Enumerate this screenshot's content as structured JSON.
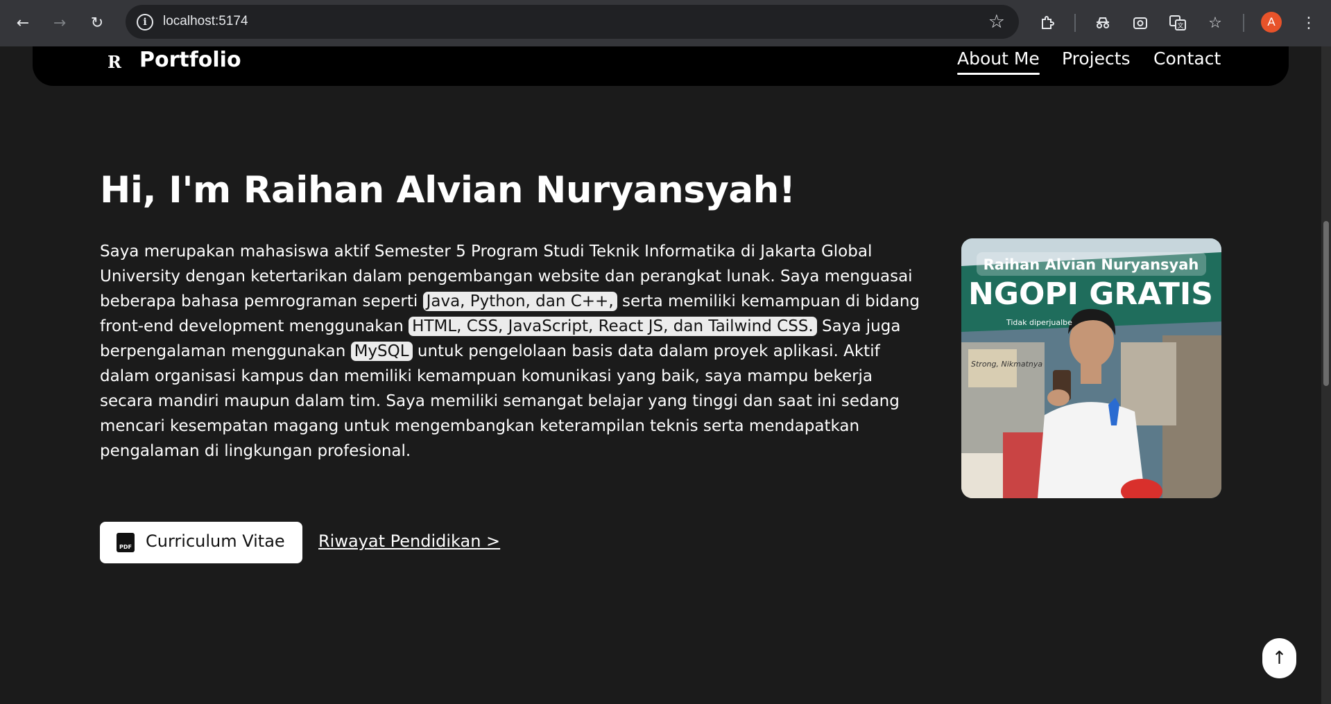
{
  "browser": {
    "url": "localhost:5174",
    "profile_initial": "A",
    "icons": [
      "back-icon",
      "forward-icon",
      "reload-icon",
      "site-info-icon",
      "bookmark-star-icon",
      "extensions-icon",
      "incognito-icon",
      "screenshot-icon",
      "translate-icon",
      "reading-list-icon",
      "menu-icon"
    ]
  },
  "navbar": {
    "logo_mark": "R",
    "logo_text": "Portfolio",
    "links": [
      {
        "label": "About Me",
        "active": true
      },
      {
        "label": "Projects",
        "active": false
      },
      {
        "label": "Contact",
        "active": false
      }
    ]
  },
  "hero": {
    "title": "Hi, I'm Raihan Alvian Nuryansyah!",
    "bio": {
      "p1": "Saya merupakan mahasiswa aktif Semester 5 Program Studi Teknik Informatika di Jakarta Global University dengan ketertarikan dalam pengembangan website dan perangkat lunak. Saya menguasai beberapa bahasa pemrograman seperti ",
      "hl1": "Java, Python, dan C++,",
      "p2": " serta memiliki kemampuan di bidang front-end development menggunakan ",
      "hl2": "HTML, CSS, JavaScript, React JS, dan Tailwind CSS.",
      "p3": " Saya juga berpengalaman menggunakan ",
      "hl3": "MySQL",
      "p4": " untuk pengelolaan basis data dalam proyek aplikasi. Aktif dalam organisasi kampus dan memiliki kemampuan komunikasi yang baik, saya mampu bekerja secara mandiri maupun dalam tim. Saya memiliki semangat belajar yang tinggi dan saat ini sedang mencari kesempatan magang untuk mengembangkan keterampilan teknis serta mendapatkan pengalaman di lingkungan profesional."
    },
    "photo": {
      "caption": "Raihan Alvian Nuryansyah",
      "banner_text": "NGOPI GRATIS",
      "banner_sub": "Tidak diperjualbe",
      "poster_text": "Strong, Nikmatnya"
    },
    "cv_button": {
      "label": "Curriculum Vitae",
      "icon_text": "PDF"
    },
    "education_link": "Riwayat Pendidikan >"
  },
  "back_to_top": "↑",
  "colors": {
    "page_bg": "#1b1b1b",
    "navbar_bg": "#000000",
    "highlight_bg": "#ececec",
    "chrome_bg": "#35363a"
  }
}
